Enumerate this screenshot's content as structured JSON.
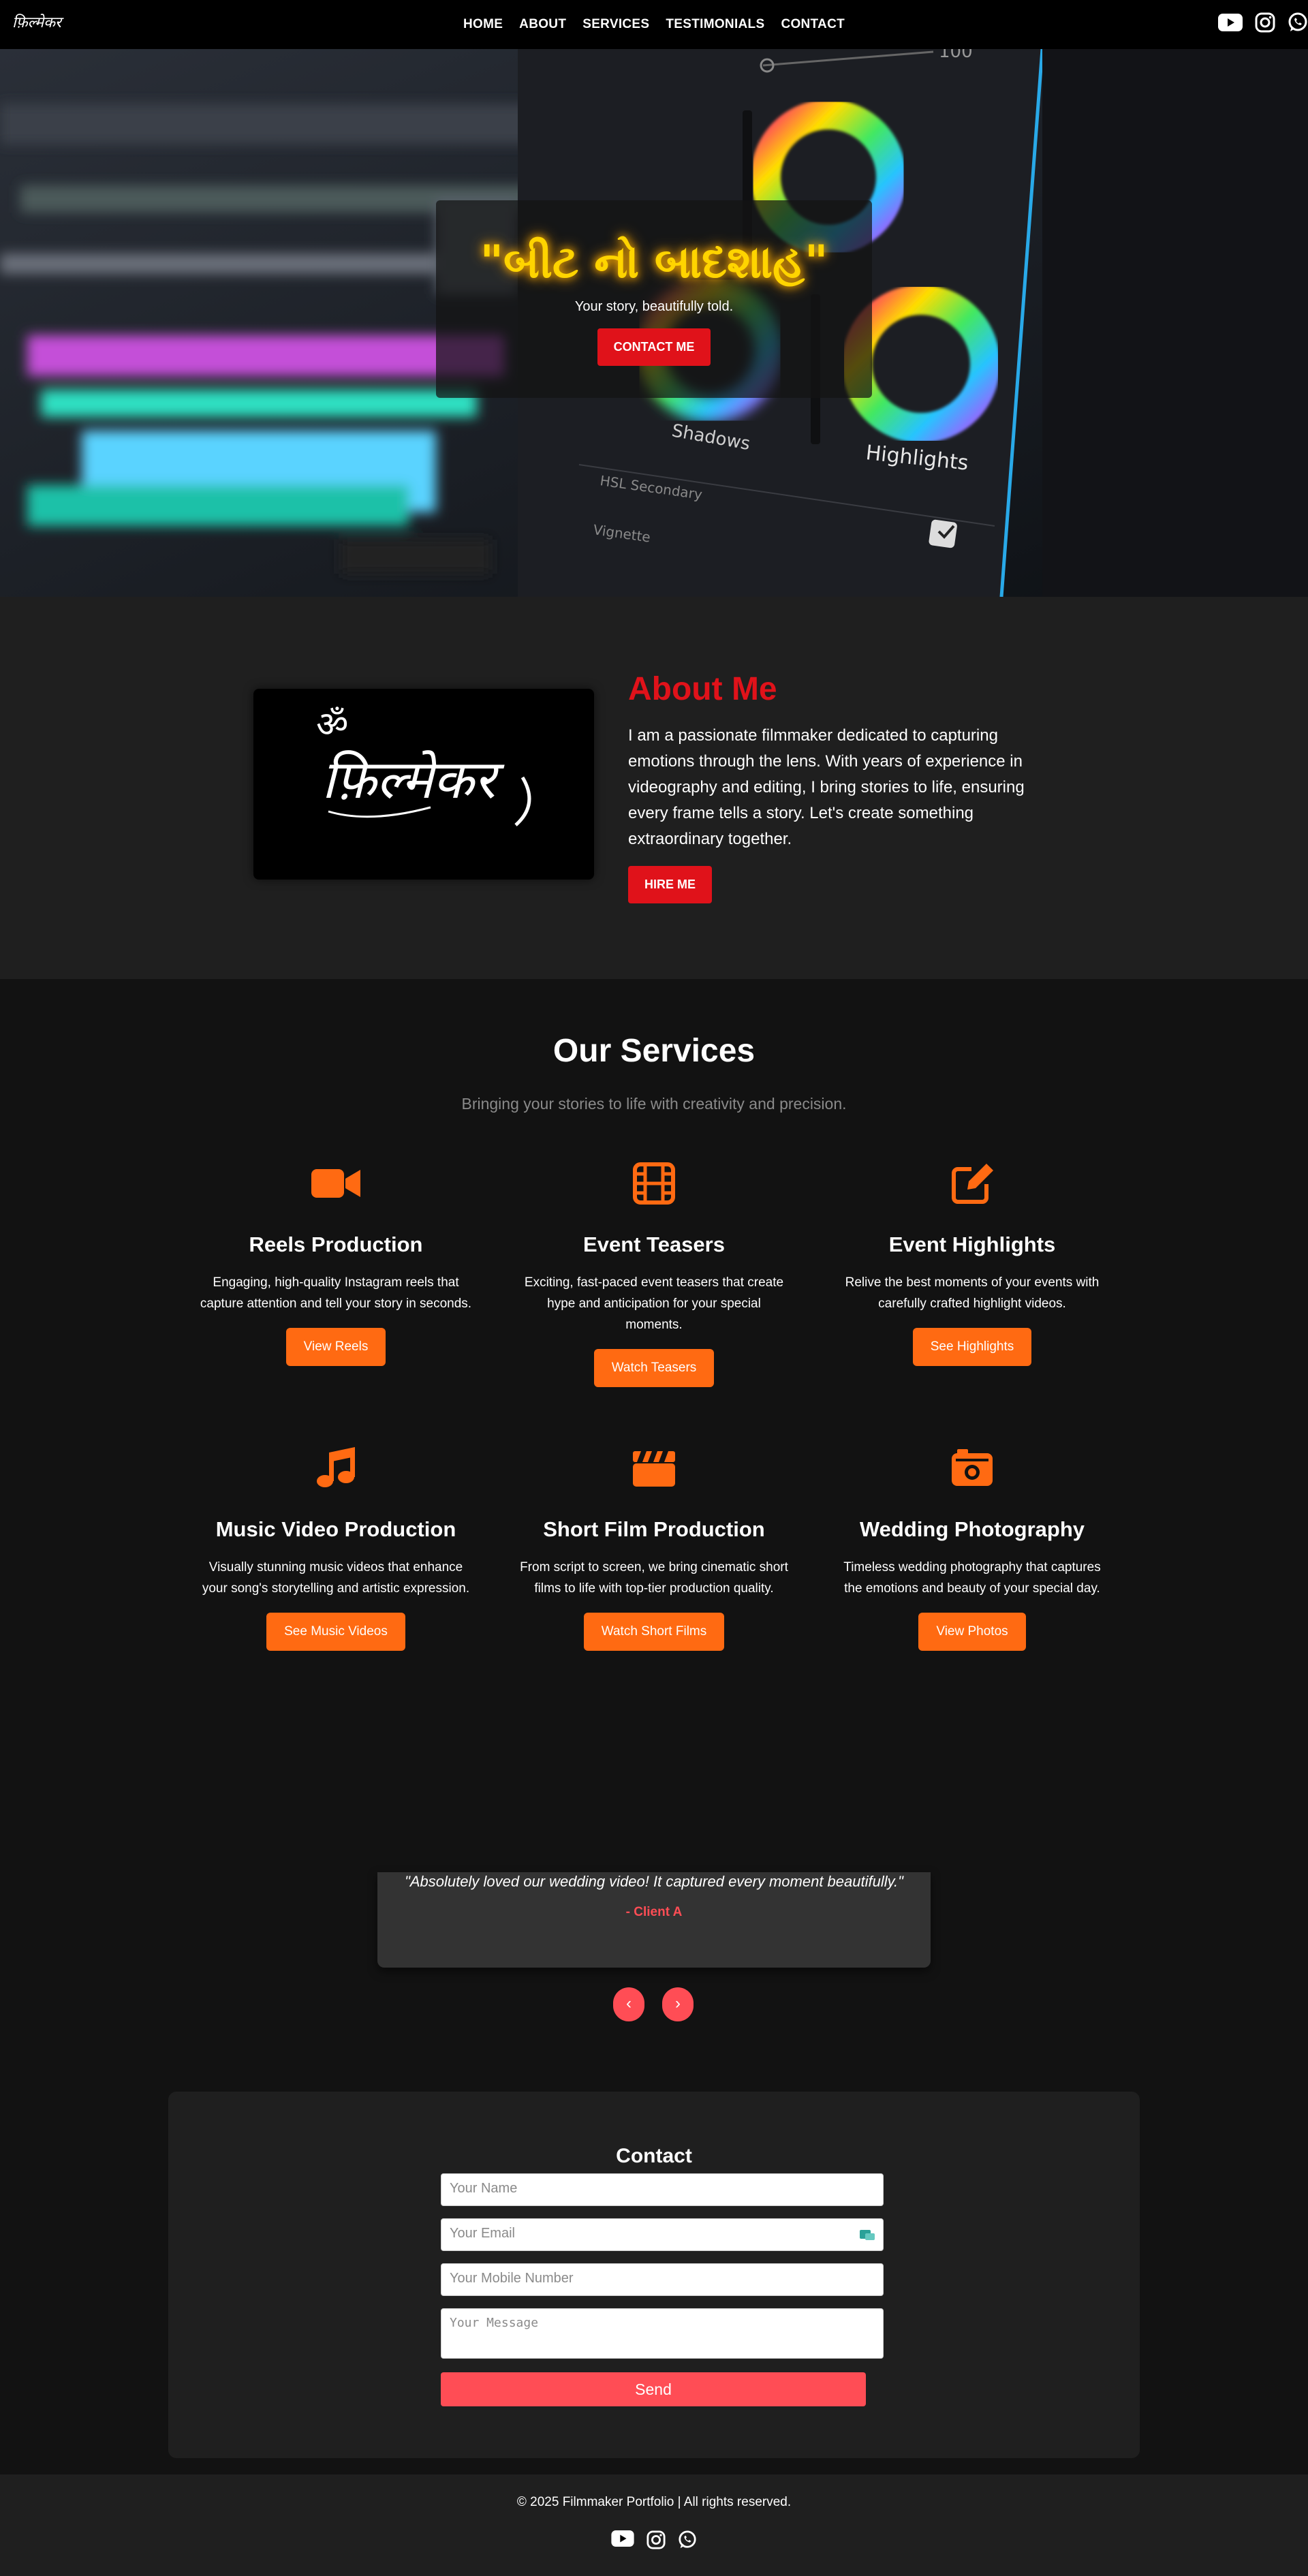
{
  "brand": {
    "logo_text": "फ़िल्मेकर"
  },
  "nav": {
    "items": [
      "HOME",
      "ABOUT",
      "SERVICES",
      "TESTIMONIALS",
      "CONTACT"
    ],
    "social_icons": [
      "youtube-icon",
      "instagram-icon",
      "whatsapp-icon"
    ]
  },
  "hero": {
    "title": "\"બીટ નો બાદશાહ\"",
    "subtitle": "Your story, beautifully told.",
    "cta": "CONTACT ME",
    "background_labels": {
      "top_value": "100",
      "shadows": "Shadows",
      "highlights": "Highlights",
      "hsl": "HSL Secondary",
      "vignette": "Vignette"
    }
  },
  "about": {
    "logo_text": "फ़िल्मेकर",
    "om_symbol": "ॐ",
    "title": "About Me",
    "paragraph": "I am a passionate filmmaker dedicated to capturing emotions through the lens. With years of experience in videography and editing, I bring stories to life, ensuring every frame tells a story. Let's create something extraordinary together.",
    "cta": "HIRE ME"
  },
  "services": {
    "title": "Our Services",
    "subtitle": "Bringing your stories to life with creativity and precision.",
    "items": [
      {
        "icon": "video-camera-icon",
        "name": "Reels Production",
        "desc": "Engaging, high-quality Instagram reels that capture attention and tell your story in seconds.",
        "cta": "View Reels"
      },
      {
        "icon": "film-icon",
        "name": "Event Teasers",
        "desc": "Exciting, fast-paced event teasers that create hype and anticipation for your special moments.",
        "cta": "Watch Teasers"
      },
      {
        "icon": "edit-icon",
        "name": "Event Highlights",
        "desc": "Relive the best moments of your events with carefully crafted highlight videos.",
        "cta": "See Highlights"
      },
      {
        "icon": "music-icon",
        "name": "Music Video Production",
        "desc": "Visually stunning music videos that enhance your song's storytelling and artistic expression.",
        "cta": "See Music Videos"
      },
      {
        "icon": "clapperboard-icon",
        "name": "Short Film Production",
        "desc": "From script to screen, we bring cinematic short films to life with top-tier production quality.",
        "cta": "Watch Short Films"
      },
      {
        "icon": "camera-icon",
        "name": "Wedding Photography",
        "desc": "Timeless wedding photography that captures the emotions and beauty of your special day.",
        "cta": "View Photos"
      }
    ]
  },
  "testimonials": {
    "quote": "\"Absolutely loved our wedding video! It captured every moment beautifully.\"",
    "author": "- Client A",
    "prev": "‹",
    "next": "›"
  },
  "contact": {
    "title": "Contact",
    "name_placeholder": "Your Name",
    "email_placeholder": "Your Email",
    "mobile_placeholder": "Your Mobile Number",
    "message_placeholder": "Your Message",
    "send": "Send"
  },
  "footer": {
    "text": "© 2025 Filmmaker Portfolio | All rights reserved.",
    "social_icons": [
      "youtube-icon",
      "instagram-icon",
      "whatsapp-icon"
    ]
  },
  "colors": {
    "accent_red": "#e0121a",
    "accent_orange": "#ff6a12",
    "testimonial_red": "#ff4d55",
    "hero_yellow": "#ffd400"
  }
}
